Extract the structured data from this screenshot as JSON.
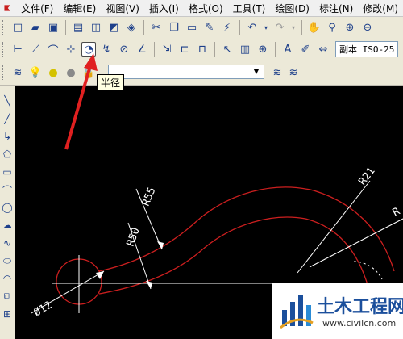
{
  "menu": [
    "文件(F)",
    "编辑(E)",
    "视图(V)",
    "插入(I)",
    "格式(O)",
    "工具(T)",
    "绘图(D)",
    "标注(N)",
    "修改(M)"
  ],
  "dim_style": "副本 ISO-25",
  "tooltip": "半径",
  "dimensions": {
    "r55": "R55",
    "r50": "R50",
    "r21": "R21",
    "r_partial": "R",
    "d12": "Ø12"
  },
  "watermark": {
    "title": "土木工程网",
    "url": "www.civilcn.com"
  },
  "colors": {
    "menubar": "#f0f0f0",
    "toolbar": "#ece9d8",
    "canvas": "#000000",
    "curve": "#cc1f1f",
    "dimension": "#ffffff",
    "annotation_arrow": "#e02020"
  },
  "icons": {
    "toolbar_active": "radius-dimension-icon"
  }
}
